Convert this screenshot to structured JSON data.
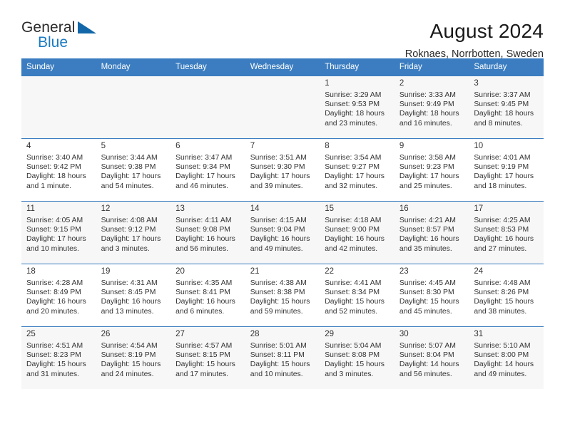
{
  "brand": {
    "name_part1": "General",
    "name_part2": "Blue",
    "accent_color": "#1267a8"
  },
  "header": {
    "title": "August 2024",
    "subtitle": "Roknaes, Norrbotten, Sweden"
  },
  "calendar": {
    "header_bg": "#3b7dc0",
    "weekdays": [
      "Sunday",
      "Monday",
      "Tuesday",
      "Wednesday",
      "Thursday",
      "Friday",
      "Saturday"
    ],
    "weeks": [
      [
        {
          "day": "",
          "sunrise": "",
          "sunset": "",
          "daylight1": "",
          "daylight2": ""
        },
        {
          "day": "",
          "sunrise": "",
          "sunset": "",
          "daylight1": "",
          "daylight2": ""
        },
        {
          "day": "",
          "sunrise": "",
          "sunset": "",
          "daylight1": "",
          "daylight2": ""
        },
        {
          "day": "",
          "sunrise": "",
          "sunset": "",
          "daylight1": "",
          "daylight2": ""
        },
        {
          "day": "1",
          "sunrise": "Sunrise: 3:29 AM",
          "sunset": "Sunset: 9:53 PM",
          "daylight1": "Daylight: 18 hours",
          "daylight2": "and 23 minutes."
        },
        {
          "day": "2",
          "sunrise": "Sunrise: 3:33 AM",
          "sunset": "Sunset: 9:49 PM",
          "daylight1": "Daylight: 18 hours",
          "daylight2": "and 16 minutes."
        },
        {
          "day": "3",
          "sunrise": "Sunrise: 3:37 AM",
          "sunset": "Sunset: 9:45 PM",
          "daylight1": "Daylight: 18 hours",
          "daylight2": "and 8 minutes."
        }
      ],
      [
        {
          "day": "4",
          "sunrise": "Sunrise: 3:40 AM",
          "sunset": "Sunset: 9:42 PM",
          "daylight1": "Daylight: 18 hours",
          "daylight2": "and 1 minute."
        },
        {
          "day": "5",
          "sunrise": "Sunrise: 3:44 AM",
          "sunset": "Sunset: 9:38 PM",
          "daylight1": "Daylight: 17 hours",
          "daylight2": "and 54 minutes."
        },
        {
          "day": "6",
          "sunrise": "Sunrise: 3:47 AM",
          "sunset": "Sunset: 9:34 PM",
          "daylight1": "Daylight: 17 hours",
          "daylight2": "and 46 minutes."
        },
        {
          "day": "7",
          "sunrise": "Sunrise: 3:51 AM",
          "sunset": "Sunset: 9:30 PM",
          "daylight1": "Daylight: 17 hours",
          "daylight2": "and 39 minutes."
        },
        {
          "day": "8",
          "sunrise": "Sunrise: 3:54 AM",
          "sunset": "Sunset: 9:27 PM",
          "daylight1": "Daylight: 17 hours",
          "daylight2": "and 32 minutes."
        },
        {
          "day": "9",
          "sunrise": "Sunrise: 3:58 AM",
          "sunset": "Sunset: 9:23 PM",
          "daylight1": "Daylight: 17 hours",
          "daylight2": "and 25 minutes."
        },
        {
          "day": "10",
          "sunrise": "Sunrise: 4:01 AM",
          "sunset": "Sunset: 9:19 PM",
          "daylight1": "Daylight: 17 hours",
          "daylight2": "and 18 minutes."
        }
      ],
      [
        {
          "day": "11",
          "sunrise": "Sunrise: 4:05 AM",
          "sunset": "Sunset: 9:15 PM",
          "daylight1": "Daylight: 17 hours",
          "daylight2": "and 10 minutes."
        },
        {
          "day": "12",
          "sunrise": "Sunrise: 4:08 AM",
          "sunset": "Sunset: 9:12 PM",
          "daylight1": "Daylight: 17 hours",
          "daylight2": "and 3 minutes."
        },
        {
          "day": "13",
          "sunrise": "Sunrise: 4:11 AM",
          "sunset": "Sunset: 9:08 PM",
          "daylight1": "Daylight: 16 hours",
          "daylight2": "and 56 minutes."
        },
        {
          "day": "14",
          "sunrise": "Sunrise: 4:15 AM",
          "sunset": "Sunset: 9:04 PM",
          "daylight1": "Daylight: 16 hours",
          "daylight2": "and 49 minutes."
        },
        {
          "day": "15",
          "sunrise": "Sunrise: 4:18 AM",
          "sunset": "Sunset: 9:00 PM",
          "daylight1": "Daylight: 16 hours",
          "daylight2": "and 42 minutes."
        },
        {
          "day": "16",
          "sunrise": "Sunrise: 4:21 AM",
          "sunset": "Sunset: 8:57 PM",
          "daylight1": "Daylight: 16 hours",
          "daylight2": "and 35 minutes."
        },
        {
          "day": "17",
          "sunrise": "Sunrise: 4:25 AM",
          "sunset": "Sunset: 8:53 PM",
          "daylight1": "Daylight: 16 hours",
          "daylight2": "and 27 minutes."
        }
      ],
      [
        {
          "day": "18",
          "sunrise": "Sunrise: 4:28 AM",
          "sunset": "Sunset: 8:49 PM",
          "daylight1": "Daylight: 16 hours",
          "daylight2": "and 20 minutes."
        },
        {
          "day": "19",
          "sunrise": "Sunrise: 4:31 AM",
          "sunset": "Sunset: 8:45 PM",
          "daylight1": "Daylight: 16 hours",
          "daylight2": "and 13 minutes."
        },
        {
          "day": "20",
          "sunrise": "Sunrise: 4:35 AM",
          "sunset": "Sunset: 8:41 PM",
          "daylight1": "Daylight: 16 hours",
          "daylight2": "and 6 minutes."
        },
        {
          "day": "21",
          "sunrise": "Sunrise: 4:38 AM",
          "sunset": "Sunset: 8:38 PM",
          "daylight1": "Daylight: 15 hours",
          "daylight2": "and 59 minutes."
        },
        {
          "day": "22",
          "sunrise": "Sunrise: 4:41 AM",
          "sunset": "Sunset: 8:34 PM",
          "daylight1": "Daylight: 15 hours",
          "daylight2": "and 52 minutes."
        },
        {
          "day": "23",
          "sunrise": "Sunrise: 4:45 AM",
          "sunset": "Sunset: 8:30 PM",
          "daylight1": "Daylight: 15 hours",
          "daylight2": "and 45 minutes."
        },
        {
          "day": "24",
          "sunrise": "Sunrise: 4:48 AM",
          "sunset": "Sunset: 8:26 PM",
          "daylight1": "Daylight: 15 hours",
          "daylight2": "and 38 minutes."
        }
      ],
      [
        {
          "day": "25",
          "sunrise": "Sunrise: 4:51 AM",
          "sunset": "Sunset: 8:23 PM",
          "daylight1": "Daylight: 15 hours",
          "daylight2": "and 31 minutes."
        },
        {
          "day": "26",
          "sunrise": "Sunrise: 4:54 AM",
          "sunset": "Sunset: 8:19 PM",
          "daylight1": "Daylight: 15 hours",
          "daylight2": "and 24 minutes."
        },
        {
          "day": "27",
          "sunrise": "Sunrise: 4:57 AM",
          "sunset": "Sunset: 8:15 PM",
          "daylight1": "Daylight: 15 hours",
          "daylight2": "and 17 minutes."
        },
        {
          "day": "28",
          "sunrise": "Sunrise: 5:01 AM",
          "sunset": "Sunset: 8:11 PM",
          "daylight1": "Daylight: 15 hours",
          "daylight2": "and 10 minutes."
        },
        {
          "day": "29",
          "sunrise": "Sunrise: 5:04 AM",
          "sunset": "Sunset: 8:08 PM",
          "daylight1": "Daylight: 15 hours",
          "daylight2": "and 3 minutes."
        },
        {
          "day": "30",
          "sunrise": "Sunrise: 5:07 AM",
          "sunset": "Sunset: 8:04 PM",
          "daylight1": "Daylight: 14 hours",
          "daylight2": "and 56 minutes."
        },
        {
          "day": "31",
          "sunrise": "Sunrise: 5:10 AM",
          "sunset": "Sunset: 8:00 PM",
          "daylight1": "Daylight: 14 hours",
          "daylight2": "and 49 minutes."
        }
      ]
    ]
  }
}
